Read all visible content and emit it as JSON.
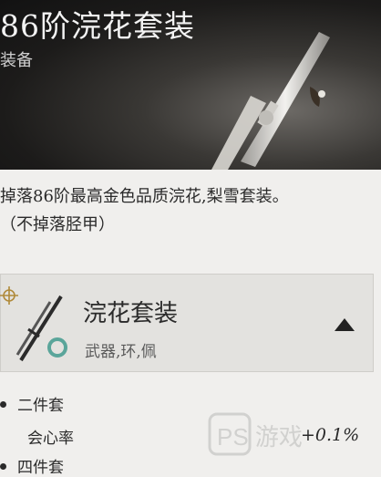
{
  "header": {
    "title": "86阶浣花套装",
    "subtitle": "装备"
  },
  "description": {
    "line1": "掉落86阶最高金色品质浣花,梨雪套装。",
    "line2": "（不掉落胫甲）"
  },
  "set_card": {
    "name": "浣花套装",
    "tags": "武器,环,佩",
    "expanded": true
  },
  "bonuses": {
    "two_piece": "二件套",
    "crit_label": "会心率",
    "crit_value": "+0.1%",
    "four_piece": "四件套"
  },
  "watermark": {
    "text": "PS 游戏"
  },
  "colors": {
    "hero_bg": "#1c1b1a",
    "panel_bg": "#f0efed",
    "card_bg": "#e3e2df",
    "text": "#2a2a2a"
  }
}
